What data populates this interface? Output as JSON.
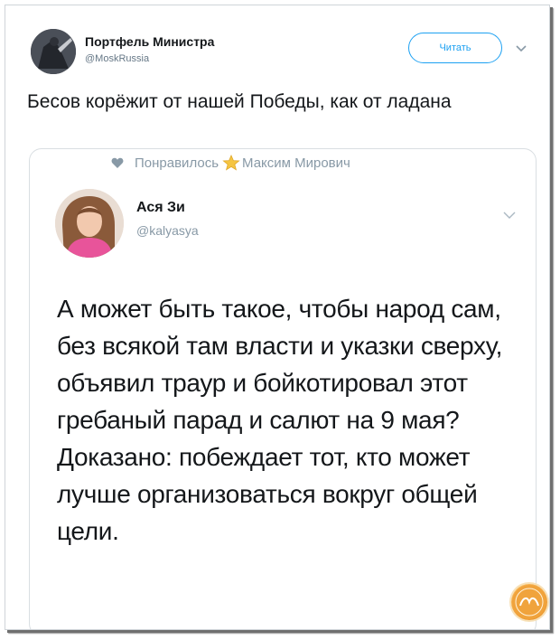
{
  "tweet": {
    "author_name": "Портфель Министра",
    "author_handle": "@MoskRussia",
    "follow_label": "Читать",
    "text": "Бесов корёжит от нашей Победы, как от ладана"
  },
  "quoted": {
    "liked_prefix": "Понравилось",
    "liked_by": "Максим Мирович",
    "author_name": "Ася Зи",
    "author_handle": "@kalyasya",
    "text": "А может быть такое, чтобы народ сам, без всякой там власти и указки сверху, объявил траур и бойкотировал этот гребаный парад и салют на 9 мая? Доказано: побеждает тот, кто может лучше организоваться вокруг общей цели."
  },
  "colors": {
    "accent": "#1da1f2",
    "secondary_text": "#657786",
    "primary_text": "#14171a"
  },
  "icons": {
    "chevron": "chevron-down-icon",
    "heart": "heart-icon",
    "star": "star-icon",
    "watermark": "watermark-logo"
  }
}
